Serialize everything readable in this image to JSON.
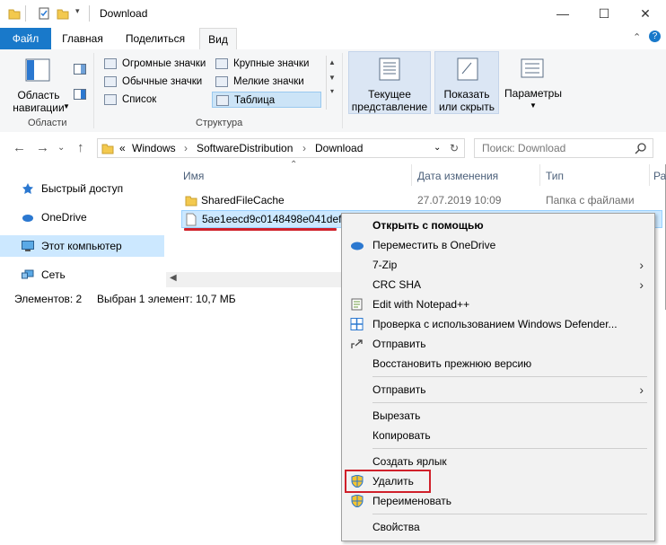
{
  "window": {
    "title": "Download"
  },
  "titlebar": {
    "minimize": "—",
    "maximize": "☐",
    "close": "✕"
  },
  "tabs": [
    "Файл",
    "Главная",
    "Поделиться",
    "Вид"
  ],
  "ribbon": {
    "nav_area_label": "Область навигации",
    "panes_group": "Области",
    "layouts": [
      "Огромные значки",
      "Крупные значки",
      "Обычные значки",
      "Мелкие значки",
      "Список",
      "Таблица"
    ],
    "structure_group": "Структура",
    "current_view": "Текущее представление",
    "show_hide": "Показать или скрыть",
    "options": "Параметры"
  },
  "address": {
    "prefix": "«",
    "crumbs": [
      "Windows",
      "SoftwareDistribution",
      "Download"
    ],
    "search_placeholder": "Поиск: Download"
  },
  "nav": [
    "Быстрый доступ",
    "OneDrive",
    "Этот компьютер",
    "Сеть"
  ],
  "columns": [
    "Имя",
    "Дата изменения",
    "Тип",
    "Ра"
  ],
  "files": [
    {
      "name": "SharedFileCache",
      "date": "27.07.2019 10:09",
      "type": "Папка с файлами"
    },
    {
      "name": "5ae1eecd9c0148498e041def4c",
      "date": "",
      "type": ""
    }
  ],
  "status": {
    "count": "Элементов: 2",
    "selected": "Выбран 1 элемент: 10,7 МБ"
  },
  "context_menu": [
    {
      "label": "Открыть с помощью",
      "bold": true
    },
    {
      "label": "Переместить в OneDrive"
    },
    {
      "label": "7-Zip",
      "submenu": true
    },
    {
      "label": "CRC SHA",
      "submenu": true
    },
    {
      "label": "Edit with Notepad++"
    },
    {
      "label": "Проверка с использованием Windows Defender..."
    },
    {
      "label": "Отправить"
    },
    {
      "label": "Восстановить прежнюю версию"
    },
    {
      "label": "Отправить",
      "submenu": true
    },
    {
      "label": "Вырезать"
    },
    {
      "label": "Копировать"
    },
    {
      "label": "Создать ярлык"
    },
    {
      "label": "Удалить"
    },
    {
      "label": "Переименовать"
    },
    {
      "label": "Свойства"
    }
  ],
  "colors": {
    "accent": "#1979ca",
    "highlight": "#d0202a",
    "selection": "#cce8ff"
  }
}
